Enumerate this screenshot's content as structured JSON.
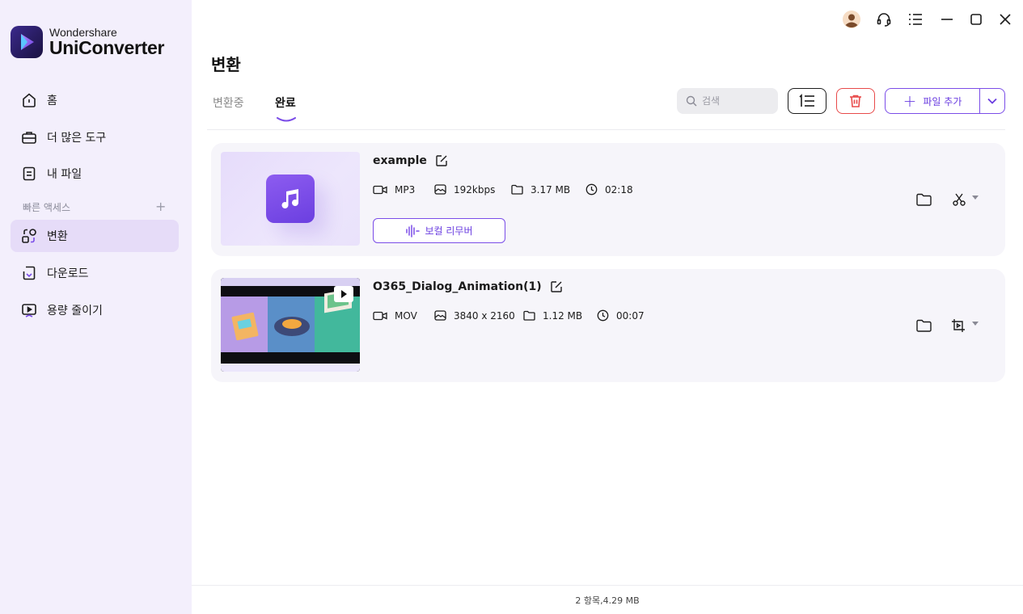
{
  "app": {
    "brand": "Wondershare",
    "product": "UniConverter"
  },
  "sidebar": {
    "items": [
      {
        "label": "홈",
        "icon": "home-icon"
      },
      {
        "label": "더 많은 도구",
        "icon": "toolbox-icon"
      },
      {
        "label": "내 파일",
        "icon": "file-icon"
      }
    ],
    "section_title": "빠른 액세스",
    "section_add": "+",
    "quick_items": [
      {
        "label": "변환",
        "icon": "convert-icon",
        "active": true
      },
      {
        "label": "다운로드",
        "icon": "download-icon"
      },
      {
        "label": "용량 줄이기",
        "icon": "compress-icon"
      }
    ]
  },
  "main": {
    "title": "변환",
    "tabs": [
      {
        "label": "변환중",
        "active": false
      },
      {
        "label": "완료",
        "active": true
      }
    ],
    "search_placeholder": "검색",
    "add_file_label": "파일 추가"
  },
  "files": [
    {
      "name": "example",
      "format": "MP3",
      "quality": "192kbps",
      "size": "3.17 MB",
      "duration": "02:18",
      "extra_button": "보컬 리무버",
      "tool_icon": "scissors-icon"
    },
    {
      "name": "O365_Dialog_Animation(1)",
      "format": "MOV",
      "quality": "3840 x 2160",
      "size": "1.12 MB",
      "duration": "00:07",
      "tool_icon": "crop-icon"
    }
  ],
  "status_bar": "2 항목,4.29 MB",
  "colors": {
    "accent": "#7b4de8",
    "sidebar_bg": "#f3effc",
    "active_nav_bg": "#e6dcf8",
    "danger": "#e84a4a"
  }
}
